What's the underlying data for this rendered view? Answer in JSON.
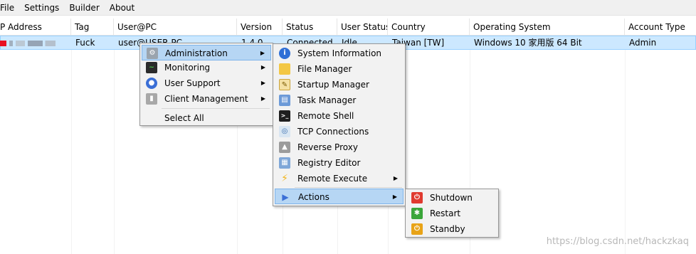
{
  "menubar": [
    "File",
    "Settings",
    "Builder",
    "About"
  ],
  "columns": [
    "P Address",
    "Tag",
    "User@PC",
    "Version",
    "Status",
    "User Status",
    "Country",
    "Operating System",
    "Account Type"
  ],
  "row": {
    "tag": "Fuck",
    "user_pc": "user@USER-PC",
    "version": "1.4.0",
    "status": "Connected",
    "user_status": "Idle",
    "country": "Taiwan [TW]",
    "os": "Windows 10 家用版 64 Bit",
    "account": "Admin"
  },
  "main_menu": {
    "items": [
      "Administration",
      "Monitoring",
      "User Support",
      "Client Management"
    ],
    "select_all": "Select All",
    "icons": [
      "gear-icon",
      "monitor-icon",
      "user-icon",
      "client-icon"
    ]
  },
  "admin_menu": {
    "items": [
      "System Information",
      "File Manager",
      "Startup Manager",
      "Task Manager",
      "Remote Shell",
      "TCP Connections",
      "Reverse Proxy",
      "Registry Editor",
      "Remote Execute"
    ],
    "actions": "Actions"
  },
  "actions_menu": {
    "items": [
      "Shutdown",
      "Restart",
      "Standby"
    ]
  },
  "watermark": "https://blog.csdn.net/hackzkaq",
  "colors": {
    "selection": "#cce8ff",
    "menu_highlight": "#b6d6f4",
    "shutdown": "#e03a2f",
    "restart": "#3aa63a",
    "standby": "#e8a317"
  }
}
